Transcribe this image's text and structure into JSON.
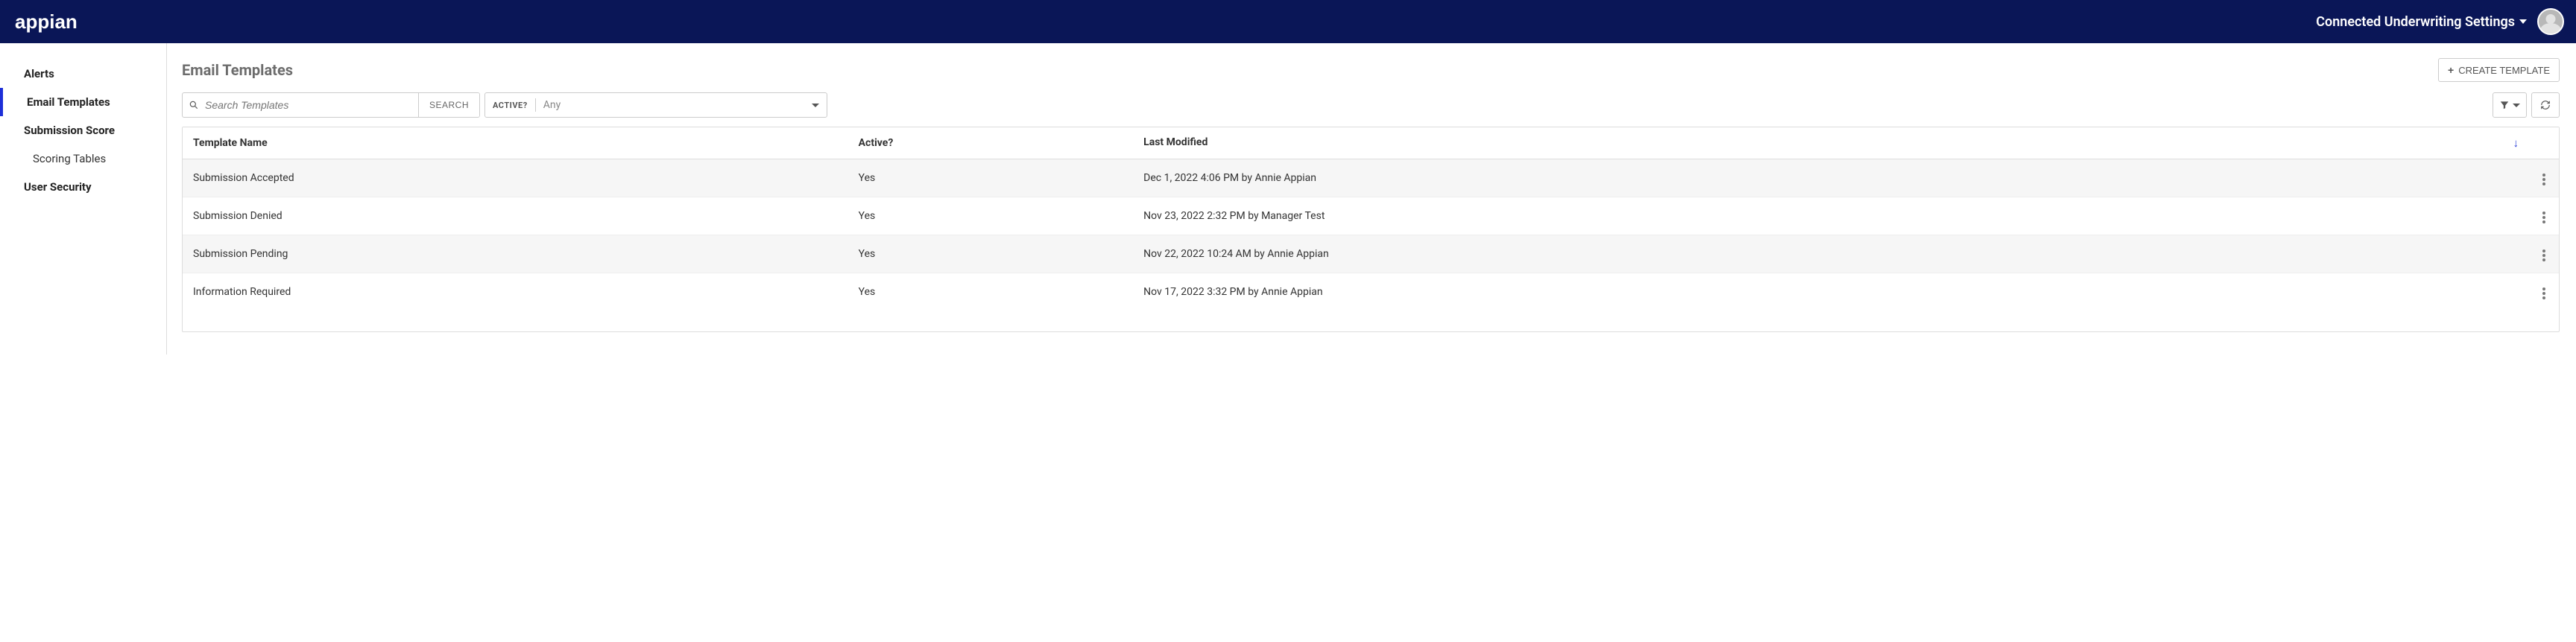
{
  "brand": "appian",
  "header": {
    "title": "Connected Underwriting Settings"
  },
  "sidebar": {
    "items": [
      {
        "label": "Alerts",
        "type": "bold"
      },
      {
        "label": "Email Templates",
        "type": "bold",
        "active": true
      },
      {
        "label": "Submission Score",
        "type": "bold"
      },
      {
        "label": "Scoring Tables",
        "type": "sub"
      },
      {
        "label": "User Security",
        "type": "bold"
      }
    ]
  },
  "page": {
    "title": "Email Templates",
    "create_label": "CREATE TEMPLATE"
  },
  "toolbar": {
    "search_placeholder": "Search Templates",
    "search_btn": "SEARCH",
    "active_filter_label": "ACTIVE?",
    "active_filter_value": "Any"
  },
  "table": {
    "columns": {
      "name": "Template Name",
      "active": "Active?",
      "modified": "Last Modified"
    },
    "sorted_column": "modified",
    "sort_dir": "desc",
    "rows": [
      {
        "name": "Submission Accepted",
        "active": "Yes",
        "modified": "Dec 1, 2022 4:06 PM by Annie Appian"
      },
      {
        "name": "Submission Denied",
        "active": "Yes",
        "modified": "Nov 23, 2022 2:32 PM by Manager Test"
      },
      {
        "name": "Submission Pending",
        "active": "Yes",
        "modified": "Nov 22, 2022 10:24 AM by Annie Appian"
      },
      {
        "name": "Information Required",
        "active": "Yes",
        "modified": "Nov 17, 2022 3:32 PM by Annie Appian"
      }
    ]
  }
}
